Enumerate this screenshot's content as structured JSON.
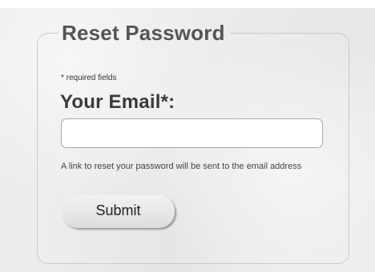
{
  "form": {
    "title": "Reset Password",
    "required_note": "* required fields",
    "email_label": "Your Email*:",
    "email_value": "",
    "email_placeholder": "",
    "help_text": "A link to reset your password will be sent to the email address",
    "submit_label": "Submit"
  }
}
